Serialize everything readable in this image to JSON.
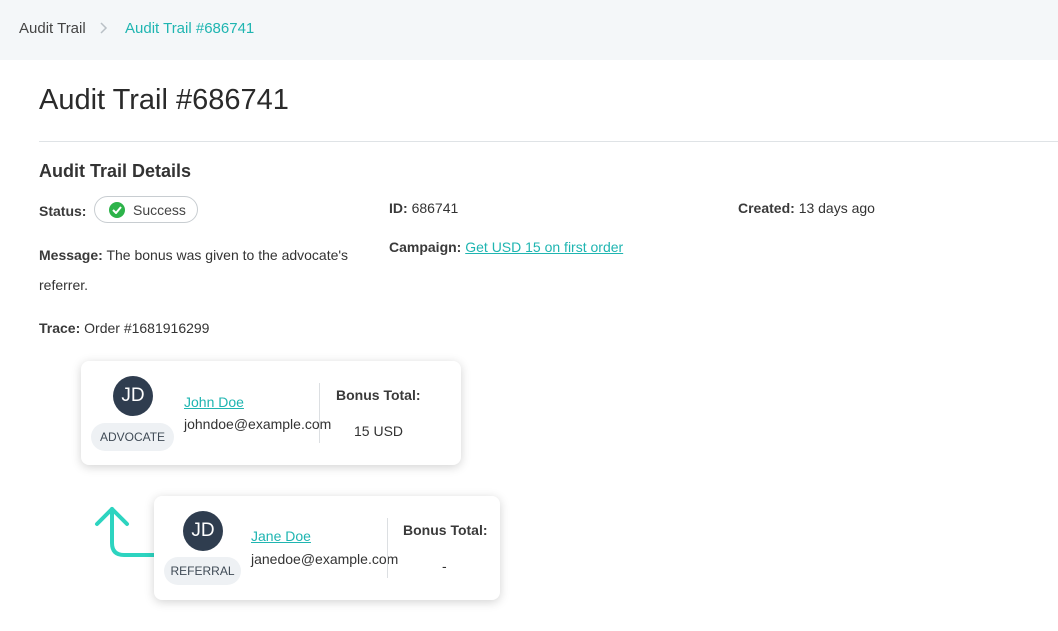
{
  "breadcrumb": {
    "root": "Audit Trail",
    "separator": ">",
    "current": "Audit Trail #686741"
  },
  "page_title": "Audit Trail #686741",
  "details": {
    "section_title": "Audit Trail Details",
    "status_label": "Status:",
    "status_value": "Success",
    "id_label": "ID:",
    "id_value": "686741",
    "created_label": "Created:",
    "created_value": "13 days ago",
    "message_label": "Message:",
    "message_line1": "The bonus was given to the advocate's",
    "message_line2": "referrer.",
    "campaign_label": "Campaign:",
    "campaign_value": "Get USD 15 on first order",
    "trace_label": "Trace:",
    "trace_value": "Order #1681916299"
  },
  "cards": [
    {
      "initials": "JD",
      "role": "ADVOCATE",
      "name": "John Doe",
      "email": "johndoe@example.com",
      "bonus_label": "Bonus Total:",
      "bonus_value": "15 USD"
    },
    {
      "initials": "JD",
      "role": "REFERRAL",
      "name": "Jane Doe",
      "email": "janedoe@example.com",
      "bonus_label": "Bonus Total:",
      "bonus_value": "-"
    }
  ],
  "colors": {
    "accent": "#1fb5b1",
    "success": "#2db34a",
    "avatar": "#2f3d4f"
  }
}
